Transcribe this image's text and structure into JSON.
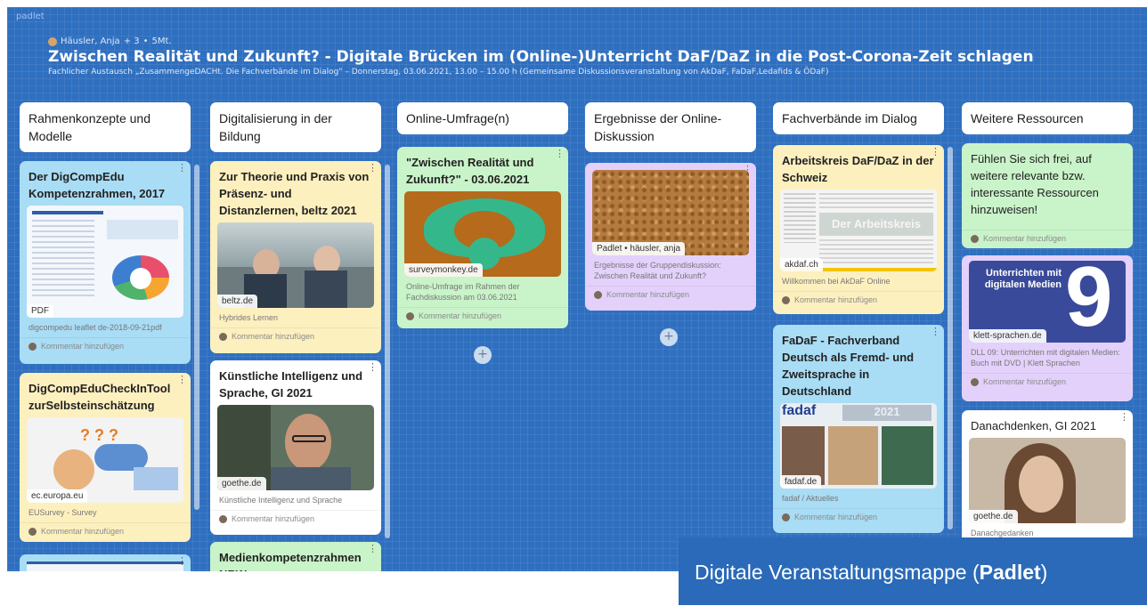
{
  "app": {
    "brand": "padlet",
    "author": "Häusler, Anja",
    "collab": "+ 3",
    "time": "5Mt."
  },
  "board": {
    "title": "Zwischen Realität und Zukunft? - Digitale Brücken im (Online-)Unterricht DaF/DaZ in die Post-Corona-Zeit schlagen",
    "subtitle": "Fachlicher Austausch „ZusammengeDACHt. Die Fachverbände im Dialog\" – Donnerstag, 03.06.2021, 13.00 – 15.00 h (Gemeinsame Diskussionsveranstaltung von AkDaF, FaDaF,Ledafids & ÖDaF)"
  },
  "comment_label": "Kommentar hinzufügen",
  "columns": [
    {
      "title": "Rahmenkonzepte und Modelle",
      "cards": [
        {
          "title": "Der DigCompEdu Kompetenzrahmen, 2017",
          "tag": "PDF",
          "desc": "digcompedu leaflet de-2018-09-21pdf"
        },
        {
          "title": "DigCompEduCheckInTool zurSelbsteinschätzung",
          "tag": "ec.europa.eu",
          "desc": "EUSurvey - Survey"
        }
      ]
    },
    {
      "title": "Digitalisierung in der Bildung",
      "cards": [
        {
          "title": "Zur Theorie und Praxis von Präsenz- und Distanzlernen, beltz 2021",
          "tag": "beltz.de",
          "desc": "Hybrides Lernen"
        },
        {
          "title": "Künstliche Intelligenz und Sprache, GI 2021",
          "tag": "goethe.de",
          "desc": "Künstliche Intelligenz und Sprache"
        },
        {
          "title": "Medienkompetenzrahmen NRW"
        }
      ]
    },
    {
      "title": "Online-Umfrage(n)",
      "cards": [
        {
          "title": "\"Zwischen Realität und Zukunft?\" - 03.06.2021",
          "tag": "surveymonkey.de",
          "desc": "Online-Umfrage im Rahmen der Fachdiskussion am 03.06.2021"
        }
      ]
    },
    {
      "title": "Ergebnisse der Online-Diskussion",
      "cards": [
        {
          "tag": "Padlet • häusler, anja",
          "desc": "Ergebnisse der Gruppendiskussion: Zwischen Realität und Zukunft?"
        }
      ]
    },
    {
      "title": "Fachverbände im Dialog",
      "cards": [
        {
          "title": "Arbeitskreis DaF/DaZ in der Schweiz",
          "tag": "akdaf.ch",
          "desc": "Willkommen bei AkDaF Online",
          "img_text": "Der Arbeitskreis"
        },
        {
          "title": "FaDaF - Fachverband Deutsch als Fremd- und Zweitsprache in Deutschland",
          "tag": "fadaf.de",
          "desc": "fadaf / Aktuelles",
          "img_text": "fadaf",
          "img_year": "2021"
        }
      ]
    },
    {
      "title": "Weitere Ressourcen",
      "cards": [
        {
          "title": "Fühlen Sie sich frei, auf weitere relevante bzw. interessante Ressourcen hinzuweisen!"
        },
        {
          "tag": "klett-sprachen.de",
          "desc": "DLL 09: Unterrichten mit digitalen Medien: Buch mit DVD | Klett Sprachen",
          "img_text": "Unterrichten mit digitalen Medien",
          "img_num": "9"
        },
        {
          "title": "Danachdenken, GI 2021",
          "tag": "goethe.de",
          "desc": "Danachgedanken"
        }
      ]
    }
  ],
  "overlay": {
    "text": "Digitale Veranstaltungsmappe (",
    "bold": "Padlet",
    "close": ")"
  },
  "colors": {
    "board": "#2f6fbf",
    "blue": "#a9dcf5",
    "yellow": "#fdf0bf",
    "green": "#c9f3c9",
    "purple": "#e3d1fb",
    "overlay": "#2a6ab8"
  }
}
